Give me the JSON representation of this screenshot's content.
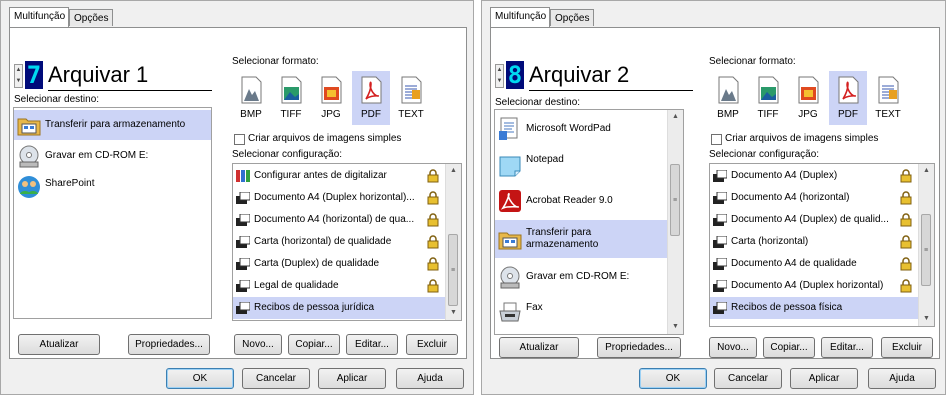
{
  "panels": [
    {
      "tabs": [
        "Multifunção",
        "Opções"
      ],
      "profile_number": "7",
      "profile_name": "Arquivar 1",
      "select_destination_label": "Selecionar destino:",
      "destinations": [
        {
          "label": "Transferir para armazenamento",
          "icon": "storage-folder-icon",
          "selected": true
        },
        {
          "label": "Gravar em CD-ROM  E:",
          "icon": "cd-rom-icon",
          "selected": false
        },
        {
          "label": "SharePoint",
          "icon": "sharepoint-icon",
          "selected": false
        }
      ],
      "select_format_label": "Selecionar formato:",
      "formats": [
        {
          "label": "BMP",
          "icon": "bmp-icon",
          "selected": false
        },
        {
          "label": "TIFF",
          "icon": "tiff-icon",
          "selected": false
        },
        {
          "label": "JPG",
          "icon": "jpg-icon",
          "selected": false
        },
        {
          "label": "PDF",
          "icon": "pdf-icon",
          "selected": true
        },
        {
          "label": "TEXT",
          "icon": "text-icon",
          "selected": false
        }
      ],
      "simple_images_label": "Criar arquivos de imagens simples",
      "simple_images_checked": false,
      "select_config_label": "Selecionar configuração:",
      "configs": [
        {
          "label": "Configurar antes de digitalizar",
          "icon": "configure-icon",
          "selected": false
        },
        {
          "label": "Documento A4 (Duplex horizontal)...",
          "icon": "scanner-icon",
          "selected": false
        },
        {
          "label": "Documento A4 (horizontal) de qua...",
          "icon": "scanner-icon",
          "selected": false
        },
        {
          "label": "Carta (horizontal) de qualidade",
          "icon": "scanner-icon",
          "selected": false
        },
        {
          "label": "Carta (Duplex) de qualidade",
          "icon": "scanner-icon",
          "selected": false
        },
        {
          "label": "Legal de qualidade",
          "icon": "scanner-icon",
          "selected": false
        },
        {
          "label": "Recibos de pessoa jurídica",
          "icon": "scanner-icon",
          "selected": true
        }
      ],
      "dest_buttons": [
        "Atualizar",
        "Propriedades..."
      ],
      "config_buttons": [
        "Novo...",
        "Copiar...",
        "Editar...",
        "Excluir"
      ],
      "dialog_buttons": [
        "OK",
        "Cancelar",
        "Aplicar",
        "Ajuda"
      ]
    },
    {
      "tabs": [
        "Multifunção",
        "Opções"
      ],
      "profile_number": "8",
      "profile_name": "Arquivar 2",
      "select_destination_label": "Selecionar destino:",
      "destinations": [
        {
          "label": "Microsoft WordPad",
          "icon": "wordpad-icon",
          "selected": false
        },
        {
          "label": "Notepad",
          "icon": "notepad-icon",
          "selected": false
        },
        {
          "label": "Acrobat Reader 9.0",
          "icon": "acrobat-icon",
          "selected": false
        },
        {
          "label": "Transferir para armazenamento",
          "icon": "storage-folder-icon",
          "selected": true
        },
        {
          "label": "Gravar em CD-ROM  E:",
          "icon": "cd-rom-icon",
          "selected": false
        },
        {
          "label": "Fax",
          "icon": "fax-icon",
          "selected": false
        }
      ],
      "select_format_label": "Selecionar formato:",
      "formats": [
        {
          "label": "BMP",
          "icon": "bmp-icon",
          "selected": false
        },
        {
          "label": "TIFF",
          "icon": "tiff-icon",
          "selected": false
        },
        {
          "label": "JPG",
          "icon": "jpg-icon",
          "selected": false
        },
        {
          "label": "PDF",
          "icon": "pdf-icon",
          "selected": true
        },
        {
          "label": "TEXT",
          "icon": "text-icon",
          "selected": false
        }
      ],
      "simple_images_label": "Criar arquivos de imagens simples",
      "simple_images_checked": false,
      "select_config_label": "Selecionar configuração:",
      "configs": [
        {
          "label": "Documento A4 (Duplex)",
          "icon": "scanner-icon",
          "selected": false
        },
        {
          "label": "Documento A4 (horizontal)",
          "icon": "scanner-icon",
          "selected": false
        },
        {
          "label": "Documento A4 (Duplex) de qualid...",
          "icon": "scanner-icon",
          "selected": false
        },
        {
          "label": "Carta (horizontal)",
          "icon": "scanner-icon",
          "selected": false
        },
        {
          "label": "Documento A4 de qualidade",
          "icon": "scanner-icon",
          "selected": false
        },
        {
          "label": "Documento A4 (Duplex horizontal)",
          "icon": "scanner-icon",
          "selected": false
        },
        {
          "label": "Recibos de pessoa física",
          "icon": "scanner-icon",
          "selected": true
        }
      ],
      "dest_buttons": [
        "Atualizar",
        "Propriedades..."
      ],
      "config_buttons": [
        "Novo...",
        "Copiar...",
        "Editar...",
        "Excluir"
      ],
      "dialog_buttons": [
        "OK",
        "Cancelar",
        "Aplicar",
        "Ajuda"
      ]
    }
  ],
  "colors": {
    "selection": "#ccd4f6",
    "digit_bg": "#000b7a",
    "digit_fg": "#00d8f0",
    "dialog_bg": "#f0f0f0"
  }
}
